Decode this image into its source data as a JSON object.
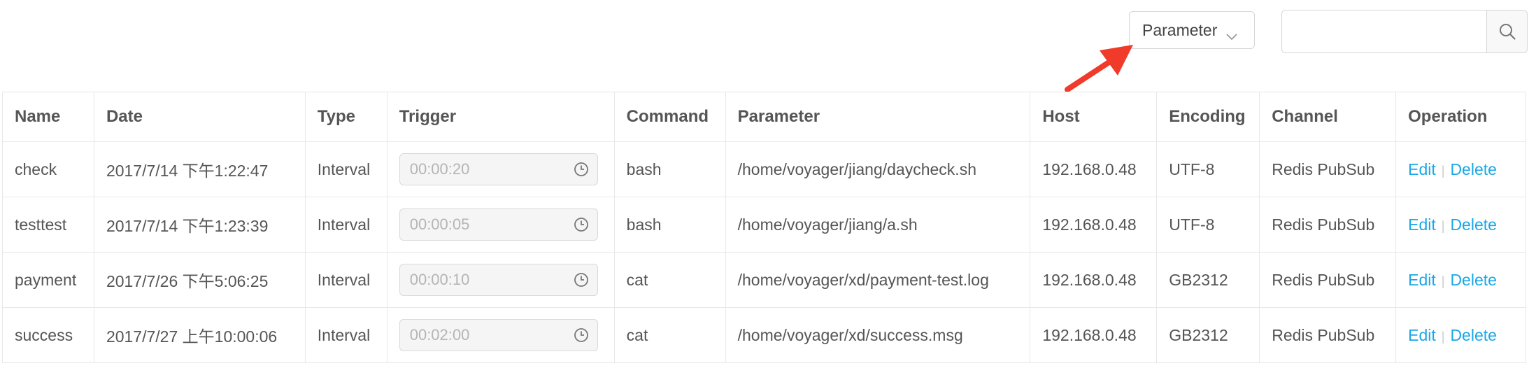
{
  "toolbar": {
    "filter_label": "Parameter",
    "search_placeholder": "",
    "search_value": ""
  },
  "table": {
    "columns": [
      "Name",
      "Date",
      "Type",
      "Trigger",
      "Command",
      "Parameter",
      "Host",
      "Encoding",
      "Channel",
      "Operation"
    ],
    "rows": [
      {
        "name": "check",
        "date": "2017/7/14 下午1:22:47",
        "type": "Interval",
        "trigger": "00:00:20",
        "command": "bash",
        "parameter": "/home/voyager/jiang/daycheck.sh",
        "host": "192.168.0.48",
        "encoding": "UTF-8",
        "channel": "Redis PubSub",
        "edit": "Edit",
        "delete": "Delete"
      },
      {
        "name": "testtest",
        "date": "2017/7/14 下午1:23:39",
        "type": "Interval",
        "trigger": "00:00:05",
        "command": "bash",
        "parameter": "/home/voyager/jiang/a.sh",
        "host": "192.168.0.48",
        "encoding": "UTF-8",
        "channel": "Redis PubSub",
        "edit": "Edit",
        "delete": "Delete"
      },
      {
        "name": "payment",
        "date": "2017/7/26 下午5:06:25",
        "type": "Interval",
        "trigger": "00:00:10",
        "command": "cat",
        "parameter": "/home/voyager/xd/payment-test.log",
        "host": "192.168.0.48",
        "encoding": "GB2312",
        "channel": "Redis PubSub",
        "edit": "Edit",
        "delete": "Delete"
      },
      {
        "name": "success",
        "date": "2017/7/27 上午10:00:06",
        "type": "Interval",
        "trigger": "00:02:00",
        "command": "cat",
        "parameter": "/home/voyager/xd/success.msg",
        "host": "192.168.0.48",
        "encoding": "GB2312",
        "channel": "Redis PubSub",
        "edit": "Edit",
        "delete": "Delete"
      }
    ]
  },
  "icons": {
    "filter_chevron": "chevron-down-icon",
    "search": "search-icon",
    "trigger_clock": "clock-icon",
    "annotation": "red-arrow"
  },
  "colors": {
    "link": "#1aa7e6",
    "annotation_arrow": "#f03a2a",
    "disabled_field": "#f5f5f5",
    "border": "#e8e8e8"
  }
}
